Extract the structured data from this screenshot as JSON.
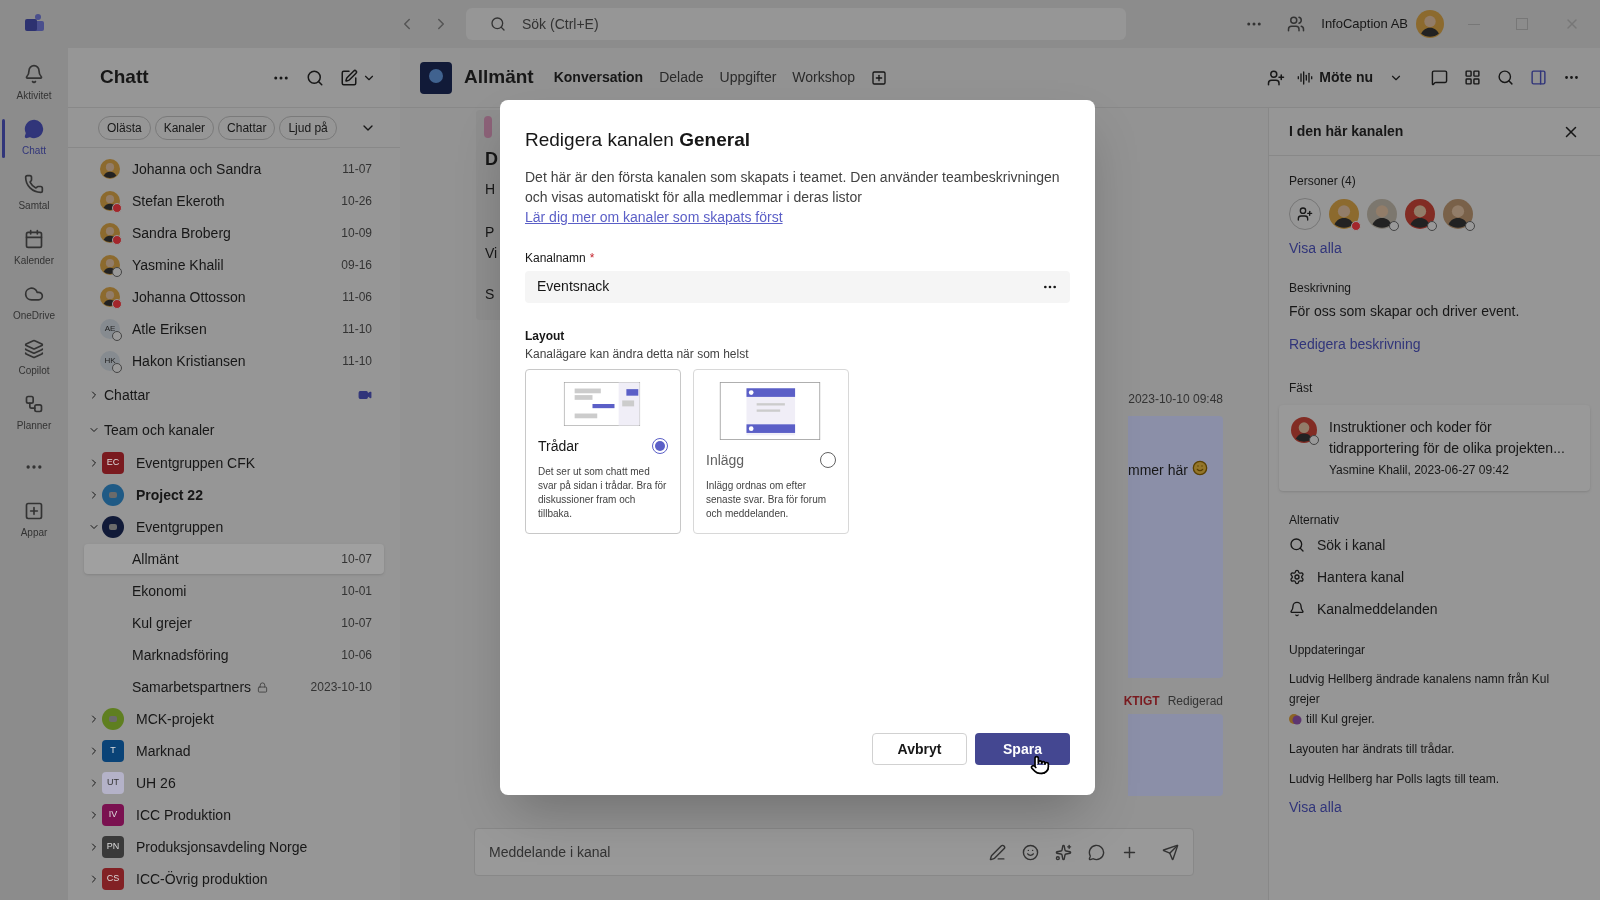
{
  "title_bar": {
    "search_placeholder": "Sök (Ctrl+E)",
    "org": "InfoCaption AB"
  },
  "rail": [
    {
      "label": "Aktivitet",
      "selected": false
    },
    {
      "label": "Chatt",
      "selected": true
    },
    {
      "label": "Samtal",
      "selected": false
    },
    {
      "label": "Kalender",
      "selected": false
    },
    {
      "label": "OneDrive",
      "selected": false
    },
    {
      "label": "Copilot",
      "selected": false
    },
    {
      "label": "Planner",
      "selected": false
    },
    {
      "label": "Appar",
      "selected": false
    }
  ],
  "chat_panel": {
    "title": "Chatt",
    "filters": [
      "Olästa",
      "Kanaler",
      "Chattar",
      "Ljud på"
    ],
    "recent": [
      {
        "name": "Johanna och Sandra",
        "date": "11-07",
        "kind": "photo"
      },
      {
        "name": "Stefan Ekeroth",
        "date": "10-26",
        "kind": "photo",
        "busy": true
      },
      {
        "name": "Sandra Broberg",
        "date": "10-09",
        "kind": "photo",
        "busy": true
      },
      {
        "name": "Yasmine Khalil",
        "date": "09-16",
        "kind": "photo",
        "busy": false
      },
      {
        "name": "Johanna Ottosson",
        "date": "11-06",
        "kind": "photo",
        "busy": true
      },
      {
        "name": "Atle Eriksen",
        "date": "11-10",
        "kind": "initials",
        "initials": "AE",
        "busy": false
      },
      {
        "name": "Hakon Kristiansen",
        "date": "11-10",
        "kind": "initials",
        "initials": "HK",
        "busy": false
      }
    ],
    "chats_section": {
      "label": "Chattar",
      "expanded": false
    },
    "teams_section": {
      "label": "Team och kanaler",
      "expanded": true
    },
    "teams": [
      {
        "name": "Eventgruppen CFK",
        "kind": "initials",
        "initials": "EC",
        "color": "#7a1a1f",
        "expanded": false,
        "unread": false
      },
      {
        "name": "Project 22",
        "kind": "picture",
        "color": "#1f5a85",
        "expanded": false,
        "unread": true
      },
      {
        "name": "Eventgruppen",
        "kind": "picture",
        "color": "#111a38",
        "expanded": true,
        "unread": false,
        "channels": [
          {
            "name": "Allmänt",
            "date": "10-07",
            "selected": true,
            "locked": false
          },
          {
            "name": "Ekonomi",
            "date": "10-01",
            "selected": false,
            "locked": false
          },
          {
            "name": "Kul grejer",
            "date": "10-07",
            "selected": false,
            "locked": false
          },
          {
            "name": "Marknadsföring",
            "date": "10-06",
            "selected": false,
            "locked": false
          },
          {
            "name": "Samarbetspartners",
            "date": "2023-10-10",
            "selected": false,
            "locked": true
          }
        ]
      },
      {
        "name": "MCK-projekt",
        "kind": "picture",
        "color": "#5f7f20",
        "expanded": false,
        "unread": false
      },
      {
        "name": "Marknad",
        "kind": "initials",
        "initials": "T",
        "color": "#0a4377",
        "expanded": false,
        "unread": false
      },
      {
        "name": "UH 26",
        "kind": "initials",
        "initials": "UT",
        "color": "#b4b2c8",
        "expanded": false,
        "unread": false
      },
      {
        "name": "ICC Produktion",
        "kind": "initials",
        "initials": "IV",
        "color": "#7a1150",
        "expanded": false,
        "unread": false
      },
      {
        "name": "Produksjonsavdeling Norge",
        "kind": "initials",
        "initials": "PN",
        "color": "#3a3a3a",
        "expanded": false,
        "unread": false
      },
      {
        "name": "ICC-Övrig produktion",
        "kind": "initials",
        "initials": "CS",
        "color": "#822125",
        "expanded": false,
        "unread": false
      }
    ]
  },
  "channel_header": {
    "name": "Allmänt",
    "tabs": [
      {
        "label": "Konversation",
        "selected": true
      },
      {
        "label": "Delade",
        "selected": false
      },
      {
        "label": "Uppgifter",
        "selected": false
      },
      {
        "label": "Workshop",
        "selected": false
      }
    ],
    "meet": "Möte nu"
  },
  "conversation": {
    "left_fragments": [
      "D",
      "H",
      "P",
      "Vi",
      "S"
    ],
    "timestamp": "2023-10-10 09:48",
    "message_fragment": "mmer här",
    "flag": "KTIGT",
    "edited": "Redigerad",
    "composer_placeholder": "Meddelande i kanal"
  },
  "right_panel": {
    "title": "I den här kanalen",
    "people_label": "Personer (4)",
    "people": [
      {
        "busy": true
      },
      {
        "busy": false
      },
      {
        "busy": false
      },
      {
        "busy": false
      }
    ],
    "people_link": "Visa alla",
    "description_label": "Beskrivning",
    "description": "För oss som skapar och driver event.",
    "description_link": "Redigera beskrivning",
    "pinned_label": "Fäst",
    "pinned": {
      "text": "Instruktioner och koder för tidrapportering för de olika projekten...",
      "meta": "Yasmine Khalil, 2023-06-27 09:42",
      "busy": false
    },
    "options_label": "Alternativ",
    "options": [
      "Sök i kanal",
      "Hantera kanal",
      "Kanalmeddelanden"
    ],
    "updates_label": "Uppdateringar",
    "updates": [
      {
        "before": "Ludvig Hellberg ändrade kanalens namn från Kul grejer",
        "after": "till Kul grejer."
      },
      {
        "before": "Layouten har ändrats till trådar."
      },
      {
        "before": "Ludvig Hellberg har Polls lagts till team."
      }
    ],
    "updates_link": "Visa alla"
  },
  "dialog": {
    "title": "Redigera kanalen **General**",
    "description": "Det här är den första kanalen som skapats i teamet. Den använder teambeskrivningen och visas automatiskt för alla medlemmar i deras listor",
    "link": "Lär dig mer om kanaler som skapats först",
    "field_label": "Kanalnamn",
    "required_mark": "*",
    "field_value": "Eventsnack",
    "layout_label": "Layout",
    "layout_hint": "Kanalägare kan ändra detta när som helst",
    "layouts": [
      {
        "kind": "threads",
        "title": "Trådar",
        "description": "Det ser ut som chatt med svar på sidan i trådar. Bra för diskussioner fram och tillbaka.",
        "selected": true
      },
      {
        "kind": "posts",
        "title": "Inlägg",
        "description": "Inlägg ordnas om efter senaste svar. Bra för forum och meddelanden.",
        "selected": false
      }
    ],
    "cancel": "Avbryt",
    "save": "Spara"
  }
}
